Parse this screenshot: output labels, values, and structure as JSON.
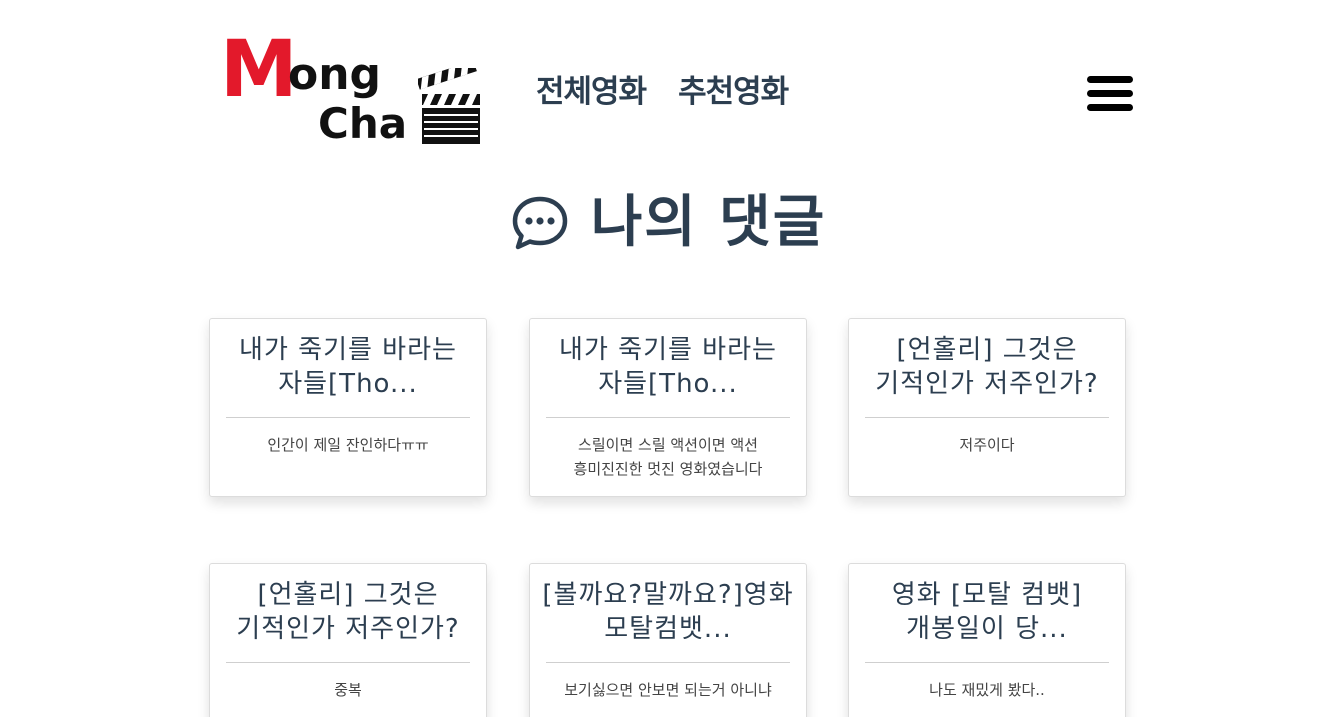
{
  "header": {
    "logo": {
      "letter_m": "M",
      "letters_ong": "ong",
      "letters_cha": "Cha"
    },
    "nav": [
      {
        "label": "전체영화"
      },
      {
        "label": "추천영화"
      }
    ],
    "menu_icon": "hamburger-menu-icon"
  },
  "main": {
    "title_icon": "speech-bubble-icon",
    "title": "나의 댓글"
  },
  "comments": [
    {
      "movie_title": "내가 죽기를 바라는 자들[Tho...",
      "comment": "인간이 제일 잔인하다ㅠㅠ"
    },
    {
      "movie_title": "내가 죽기를 바라는 자들[Tho...",
      "comment": "스릴이면 스릴 액션이면 액션 흥미진진한 멋진 영화였습니다"
    },
    {
      "movie_title": "[언홀리] 그것은 기적인가 저주인가?",
      "comment": "저주이다"
    },
    {
      "movie_title": "[언홀리] 그것은 기적인가 저주인가?",
      "comment": "중복"
    },
    {
      "movie_title": "[볼까요?말까요?]영화 모탈컴뱃...",
      "comment": "보기싫으면 안보면 되는거 아니냐"
    },
    {
      "movie_title": "영화 [모탈 컴뱃] 개봉일이 당...",
      "comment": "나도 재밌게 봤다.."
    }
  ],
  "colors": {
    "logo_red": "#e3192b",
    "text_dark": "#2c3e50",
    "logo_black": "#111111"
  }
}
